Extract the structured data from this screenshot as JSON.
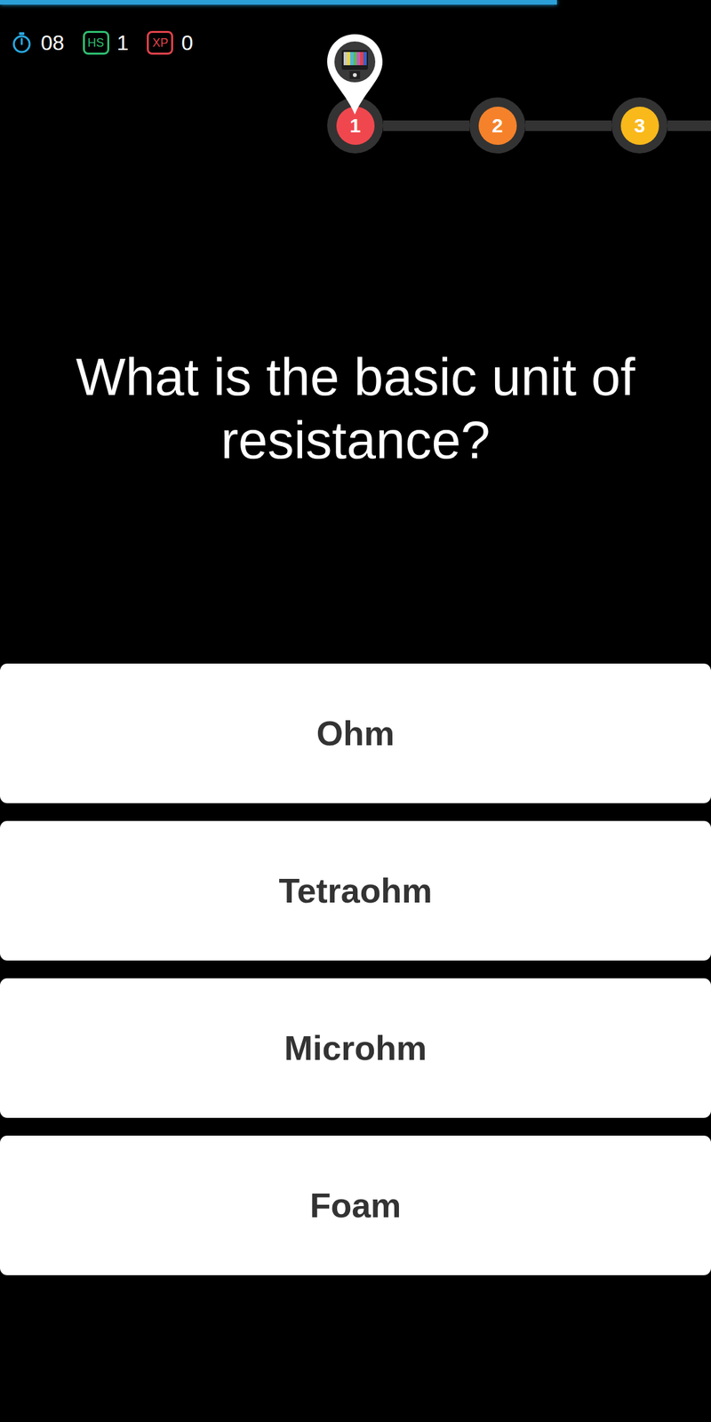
{
  "progress": {
    "level": 0.783
  },
  "stats": {
    "timer": "08",
    "badges": [
      {
        "label": "HS",
        "value": "1",
        "color": "#2fbf71"
      },
      {
        "label": "XP",
        "value": "0",
        "color": "#e0424b"
      }
    ]
  },
  "levels": [
    {
      "label": "1",
      "selected": true,
      "color": "#f0474e"
    },
    {
      "label": "2",
      "selected": false,
      "color": "#f5822a"
    },
    {
      "label": "3",
      "selected": false,
      "color": "#f9b91b"
    }
  ],
  "question": "What is the basic unit of resistance?",
  "answers": [
    {
      "label": "Ohm",
      "selected": false
    },
    {
      "label": "Tetraohm",
      "selected": false
    },
    {
      "label": "Microhm",
      "selected": false
    },
    {
      "label": "Foam",
      "selected": false
    }
  ]
}
